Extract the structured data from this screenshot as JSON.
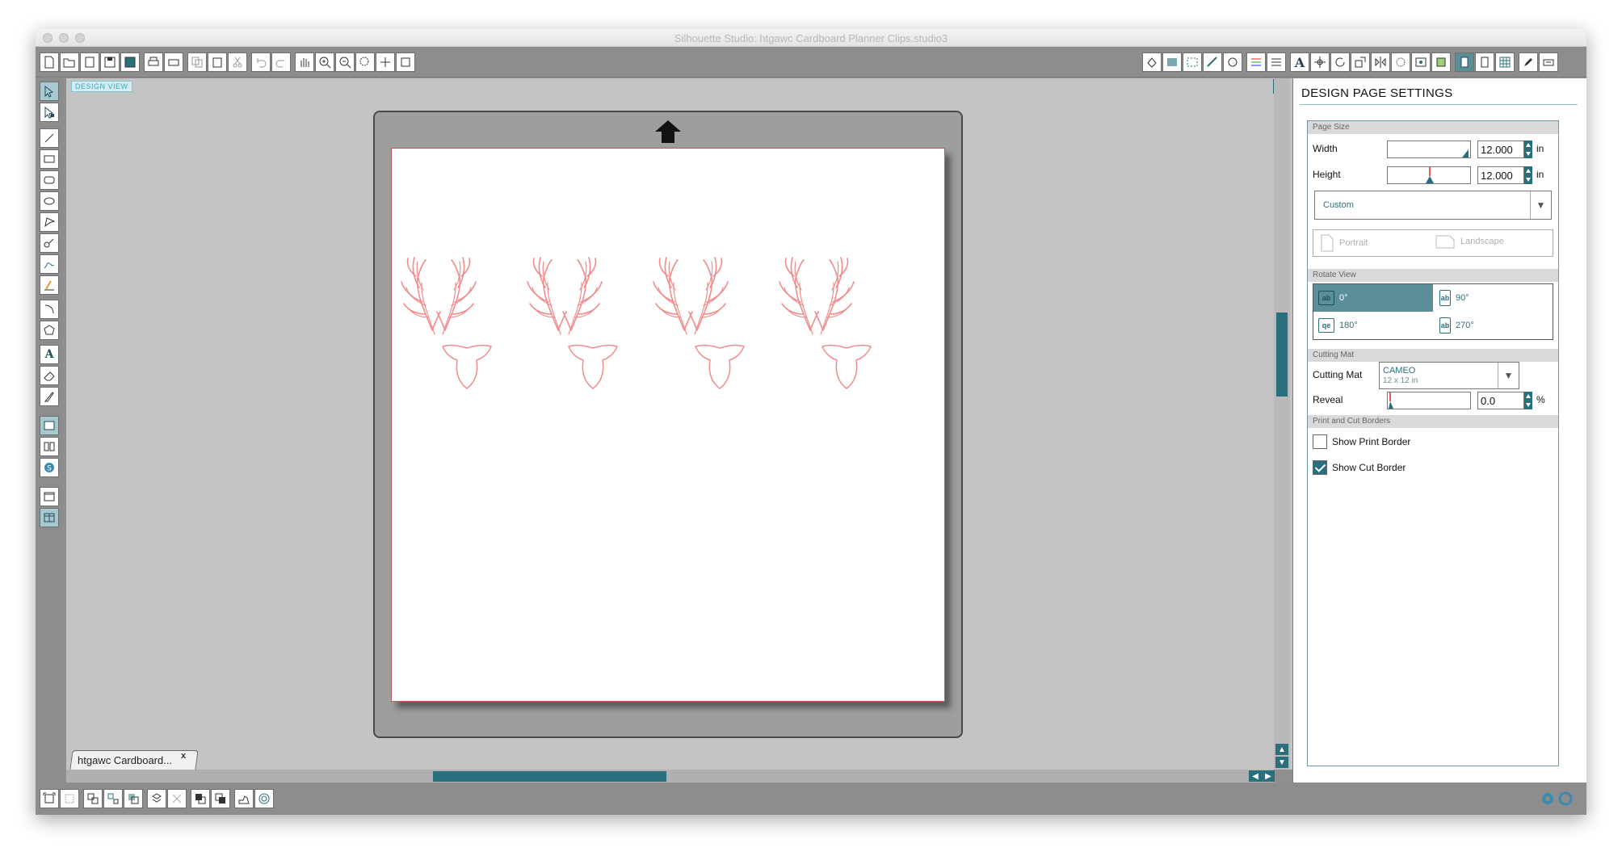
{
  "window": {
    "title": "Silhouette Studio: htgawc Cardboard Planner Clips.studio3"
  },
  "canvas": {
    "view_label": "DESIGN VIEW"
  },
  "document_tab": {
    "label": "htgawc Cardboard...",
    "close": "x"
  },
  "panel": {
    "title": "DESIGN PAGE SETTINGS",
    "page_size": {
      "header": "Page Size",
      "width_label": "Width",
      "width_value": "12.000",
      "height_label": "Height",
      "height_value": "12.000",
      "unit": "in",
      "size_preset": "Custom",
      "portrait_label": "Portrait",
      "landscape_label": "Landscape"
    },
    "rotate_view": {
      "header": "Rotate View",
      "options": [
        "0°",
        "90°",
        "180°",
        "270°"
      ],
      "selected": "0°"
    },
    "cutting_mat": {
      "header": "Cutting Mat",
      "label": "Cutting Mat",
      "value": "CAMEO",
      "value_sub": "12 x 12 in",
      "reveal_label": "Reveal",
      "reveal_value": "0.0",
      "reveal_unit": "%"
    },
    "borders": {
      "header": "Print and Cut Borders",
      "show_print_border": {
        "label": "Show Print Border",
        "checked": false
      },
      "show_cut_border": {
        "label": "Show Cut Border",
        "checked": true
      }
    }
  },
  "colors": {
    "accent": "#2a6f7e",
    "cut_line": "#f08c8c",
    "mat": "#9e9e9e",
    "canvas": "#c4c4c4"
  },
  "design": {
    "antler_sets": 4,
    "deer_heads": 4
  }
}
